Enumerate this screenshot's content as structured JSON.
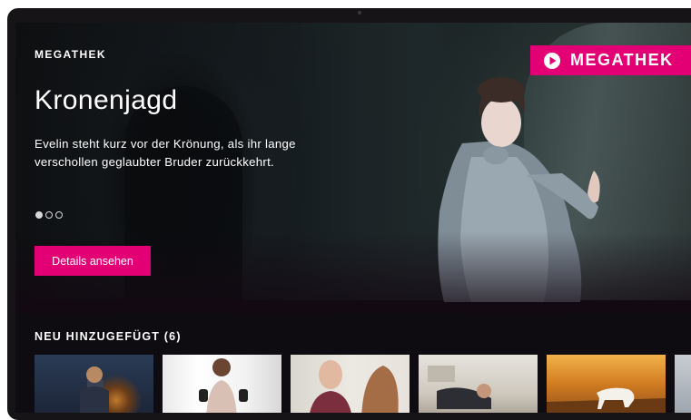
{
  "brand": {
    "label": "MEGATHEK",
    "badge_text": "MEGATHEK",
    "accent": "#e20074"
  },
  "hero": {
    "title": "Kronenjagd",
    "description": "Evelin steht kurz vor der Krönung, als ihr lange verschollen geglaubter Bruder zurückkehrt.",
    "cta_label": "Details ansehen",
    "carousel": {
      "total": 3,
      "active": 1
    }
  },
  "rail": {
    "title": "NEU HINZUGEFÜGT (6)",
    "items": [
      {
        "name": "tile-1"
      },
      {
        "name": "tile-2"
      },
      {
        "name": "tile-3"
      },
      {
        "name": "tile-4"
      },
      {
        "name": "tile-5"
      },
      {
        "name": "tile-6"
      }
    ]
  }
}
